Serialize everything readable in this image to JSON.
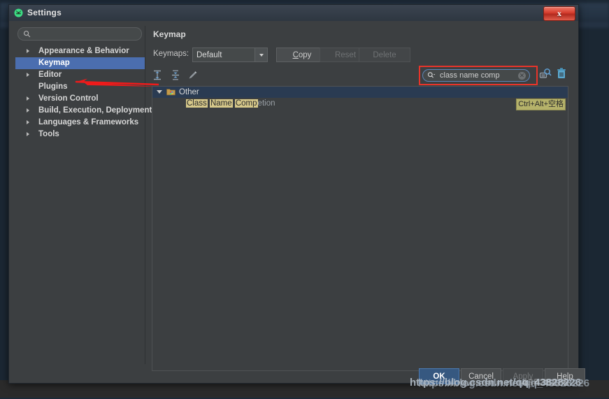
{
  "window": {
    "title": "Settings",
    "app_icon": "android-studio-icon",
    "close_label": "x"
  },
  "sidebar": {
    "search": {
      "value": "",
      "placeholder": "",
      "icon": "search-icon"
    },
    "items": [
      {
        "label": "Appearance & Behavior",
        "expandable": true,
        "selected": false
      },
      {
        "label": "Keymap",
        "expandable": false,
        "selected": true
      },
      {
        "label": "Editor",
        "expandable": true,
        "selected": false
      },
      {
        "label": "Plugins",
        "expandable": false,
        "selected": false
      },
      {
        "label": "Version Control",
        "expandable": true,
        "selected": false
      },
      {
        "label": "Build, Execution, Deployment",
        "expandable": true,
        "selected": false
      },
      {
        "label": "Languages & Frameworks",
        "expandable": true,
        "selected": false
      },
      {
        "label": "Tools",
        "expandable": true,
        "selected": false
      }
    ]
  },
  "content": {
    "title": "Keymap",
    "keymaps_label": "Keymaps:",
    "keymap_selected": "Default",
    "buttons": {
      "copy": "Copy",
      "copy_mnemonic": "C",
      "reset": "Reset",
      "delete": "Delete"
    },
    "toolbar_icons": [
      "expand-all-icon",
      "collapse-all-icon",
      "edit-pencil-icon"
    ],
    "search": {
      "value": "class name comp",
      "icon": "search-dropdown-icon",
      "clear_icon": "clear-x-icon"
    },
    "side_icons": [
      "find-shortcut-icon",
      "trash-icon"
    ],
    "tree": {
      "group": {
        "label": "Other",
        "icon": "folder-icon",
        "expanded": true
      },
      "action": {
        "highlight_parts": [
          "Class",
          "Name",
          "Comp"
        ],
        "remainder": "etion",
        "shortcut": "Ctrl+Alt+空格"
      }
    }
  },
  "footer": {
    "ok": "OK",
    "cancel": "Cancel",
    "apply": "Apply",
    "help": "Help"
  },
  "watermark": {
    "line_a": "https://blog.csdn.net/qq_43828226",
    "line_b": "https://blog.csdn.net/qq_43828226",
    "line_c": "43828226"
  },
  "colors": {
    "selection_blue": "#4b6eaf",
    "accent_red": "#e8342a",
    "highlight_tan": "#d6c88a",
    "shortcut_olive": "#b5b26a",
    "primary_button": "#365880"
  }
}
